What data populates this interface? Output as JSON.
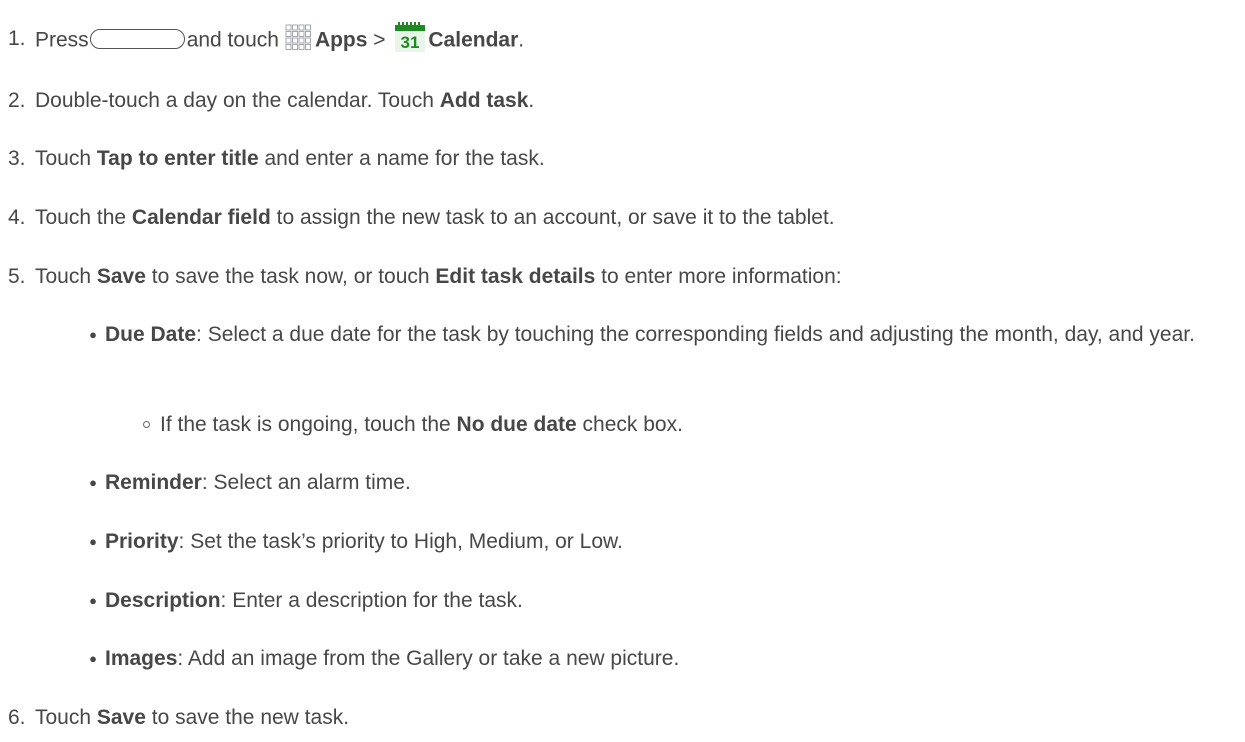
{
  "steps": [
    {
      "num": "1.",
      "parts": [
        "Press",
        "and touch",
        "Apps",
        ">",
        "Calendar",
        "."
      ]
    },
    {
      "num": "2.",
      "before": "Double-touch a day on the calendar. Touch ",
      "bold": "Add task",
      "after": "."
    },
    {
      "num": "3.",
      "before": "Touch ",
      "bold": "Tap to enter title",
      "after": " and enter a name for the task."
    },
    {
      "num": "4.",
      "before": "Touch the ",
      "bold": "Calendar field",
      "after": " to assign the new task to an account, or save it to the tablet."
    },
    {
      "num": "5.",
      "before": "Touch ",
      "bold": "Save",
      "middle": " to save the task now, or touch ",
      "bold2": "Edit task details",
      "after": " to enter more information:"
    },
    {
      "num": "6.",
      "before": "Touch ",
      "bold": "Save",
      "after": " to save the new task."
    }
  ],
  "bullets": [
    {
      "bold": "Due Date",
      "text": ": Select a due date for the task by touching the corresponding fields and adjusting the month, day, and year."
    },
    {
      "bold": "Reminder",
      "text": ": Select an alarm time."
    },
    {
      "bold": "Priority",
      "text": ": Set the task’s priority to High, Medium, or Low."
    },
    {
      "bold": "Description",
      "text": ": Enter a description for the task."
    },
    {
      "bold": "Images",
      "text": ": Add an image from the Gallery or take a new picture."
    }
  ],
  "sub_bullet": {
    "before": "If the task is ongoing, touch the ",
    "bold": "No due date",
    "after": " check box."
  },
  "icons": {
    "calendar_day": "31",
    "calendar_green": "#1e8a22",
    "apps_grid_color": "#9aa0a6"
  },
  "bullet_glyph": "●"
}
